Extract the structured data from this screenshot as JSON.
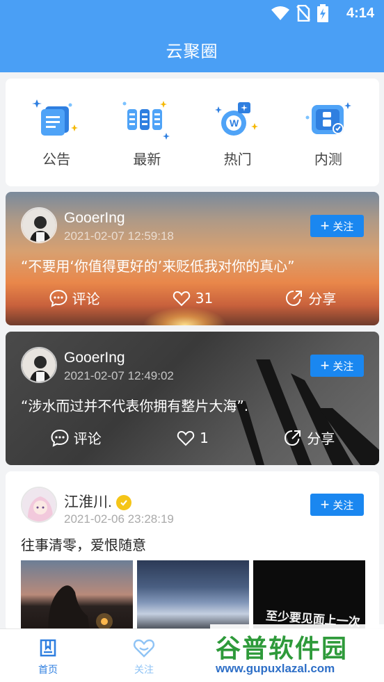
{
  "status": {
    "time": "4:14",
    "icons": [
      "wifi-icon",
      "no-sim-icon",
      "battery-charging-icon"
    ]
  },
  "appbar": {
    "title": "云聚圈"
  },
  "categories": [
    {
      "label": "公告",
      "icon": "announcement-icon"
    },
    {
      "label": "最新",
      "icon": "latest-icon"
    },
    {
      "label": "热门",
      "icon": "hot-icon"
    },
    {
      "label": "内测",
      "icon": "beta-test-icon"
    }
  ],
  "posts": [
    {
      "user": "GooerIng",
      "time": "2021-02-07 12:59:18",
      "follow": "关注",
      "content": "“不要用‘你值得更好的’来贬低我对你的真心”",
      "comment": "评论",
      "likes": "31",
      "share": "分享"
    },
    {
      "user": "GooerIng",
      "time": "2021-02-07 12:49:02",
      "follow": "关注",
      "content": "“涉水而过并不代表你拥有整片大海”.",
      "comment": "评论",
      "likes": "1",
      "share": "分享"
    },
    {
      "user": "江淮川.",
      "time": "2021-02-06 23:28:19",
      "follow": "关注",
      "content": "往事清零，爱恨随意",
      "thumb_text": "至少要见面上一次"
    }
  ],
  "tabs": [
    {
      "label": "首页",
      "icon": "home-icon",
      "active": true
    },
    {
      "label": "关注",
      "icon": "heart-icon",
      "active": false
    }
  ],
  "watermark": {
    "line1": "谷普软件园",
    "line2": "www.gupuxlazal.com"
  },
  "colors": {
    "primary": "#4a9ff5",
    "follow_button": "#1a87f0",
    "active_tab": "#2f7fe0",
    "inactive_tab": "#8fc3f5"
  }
}
